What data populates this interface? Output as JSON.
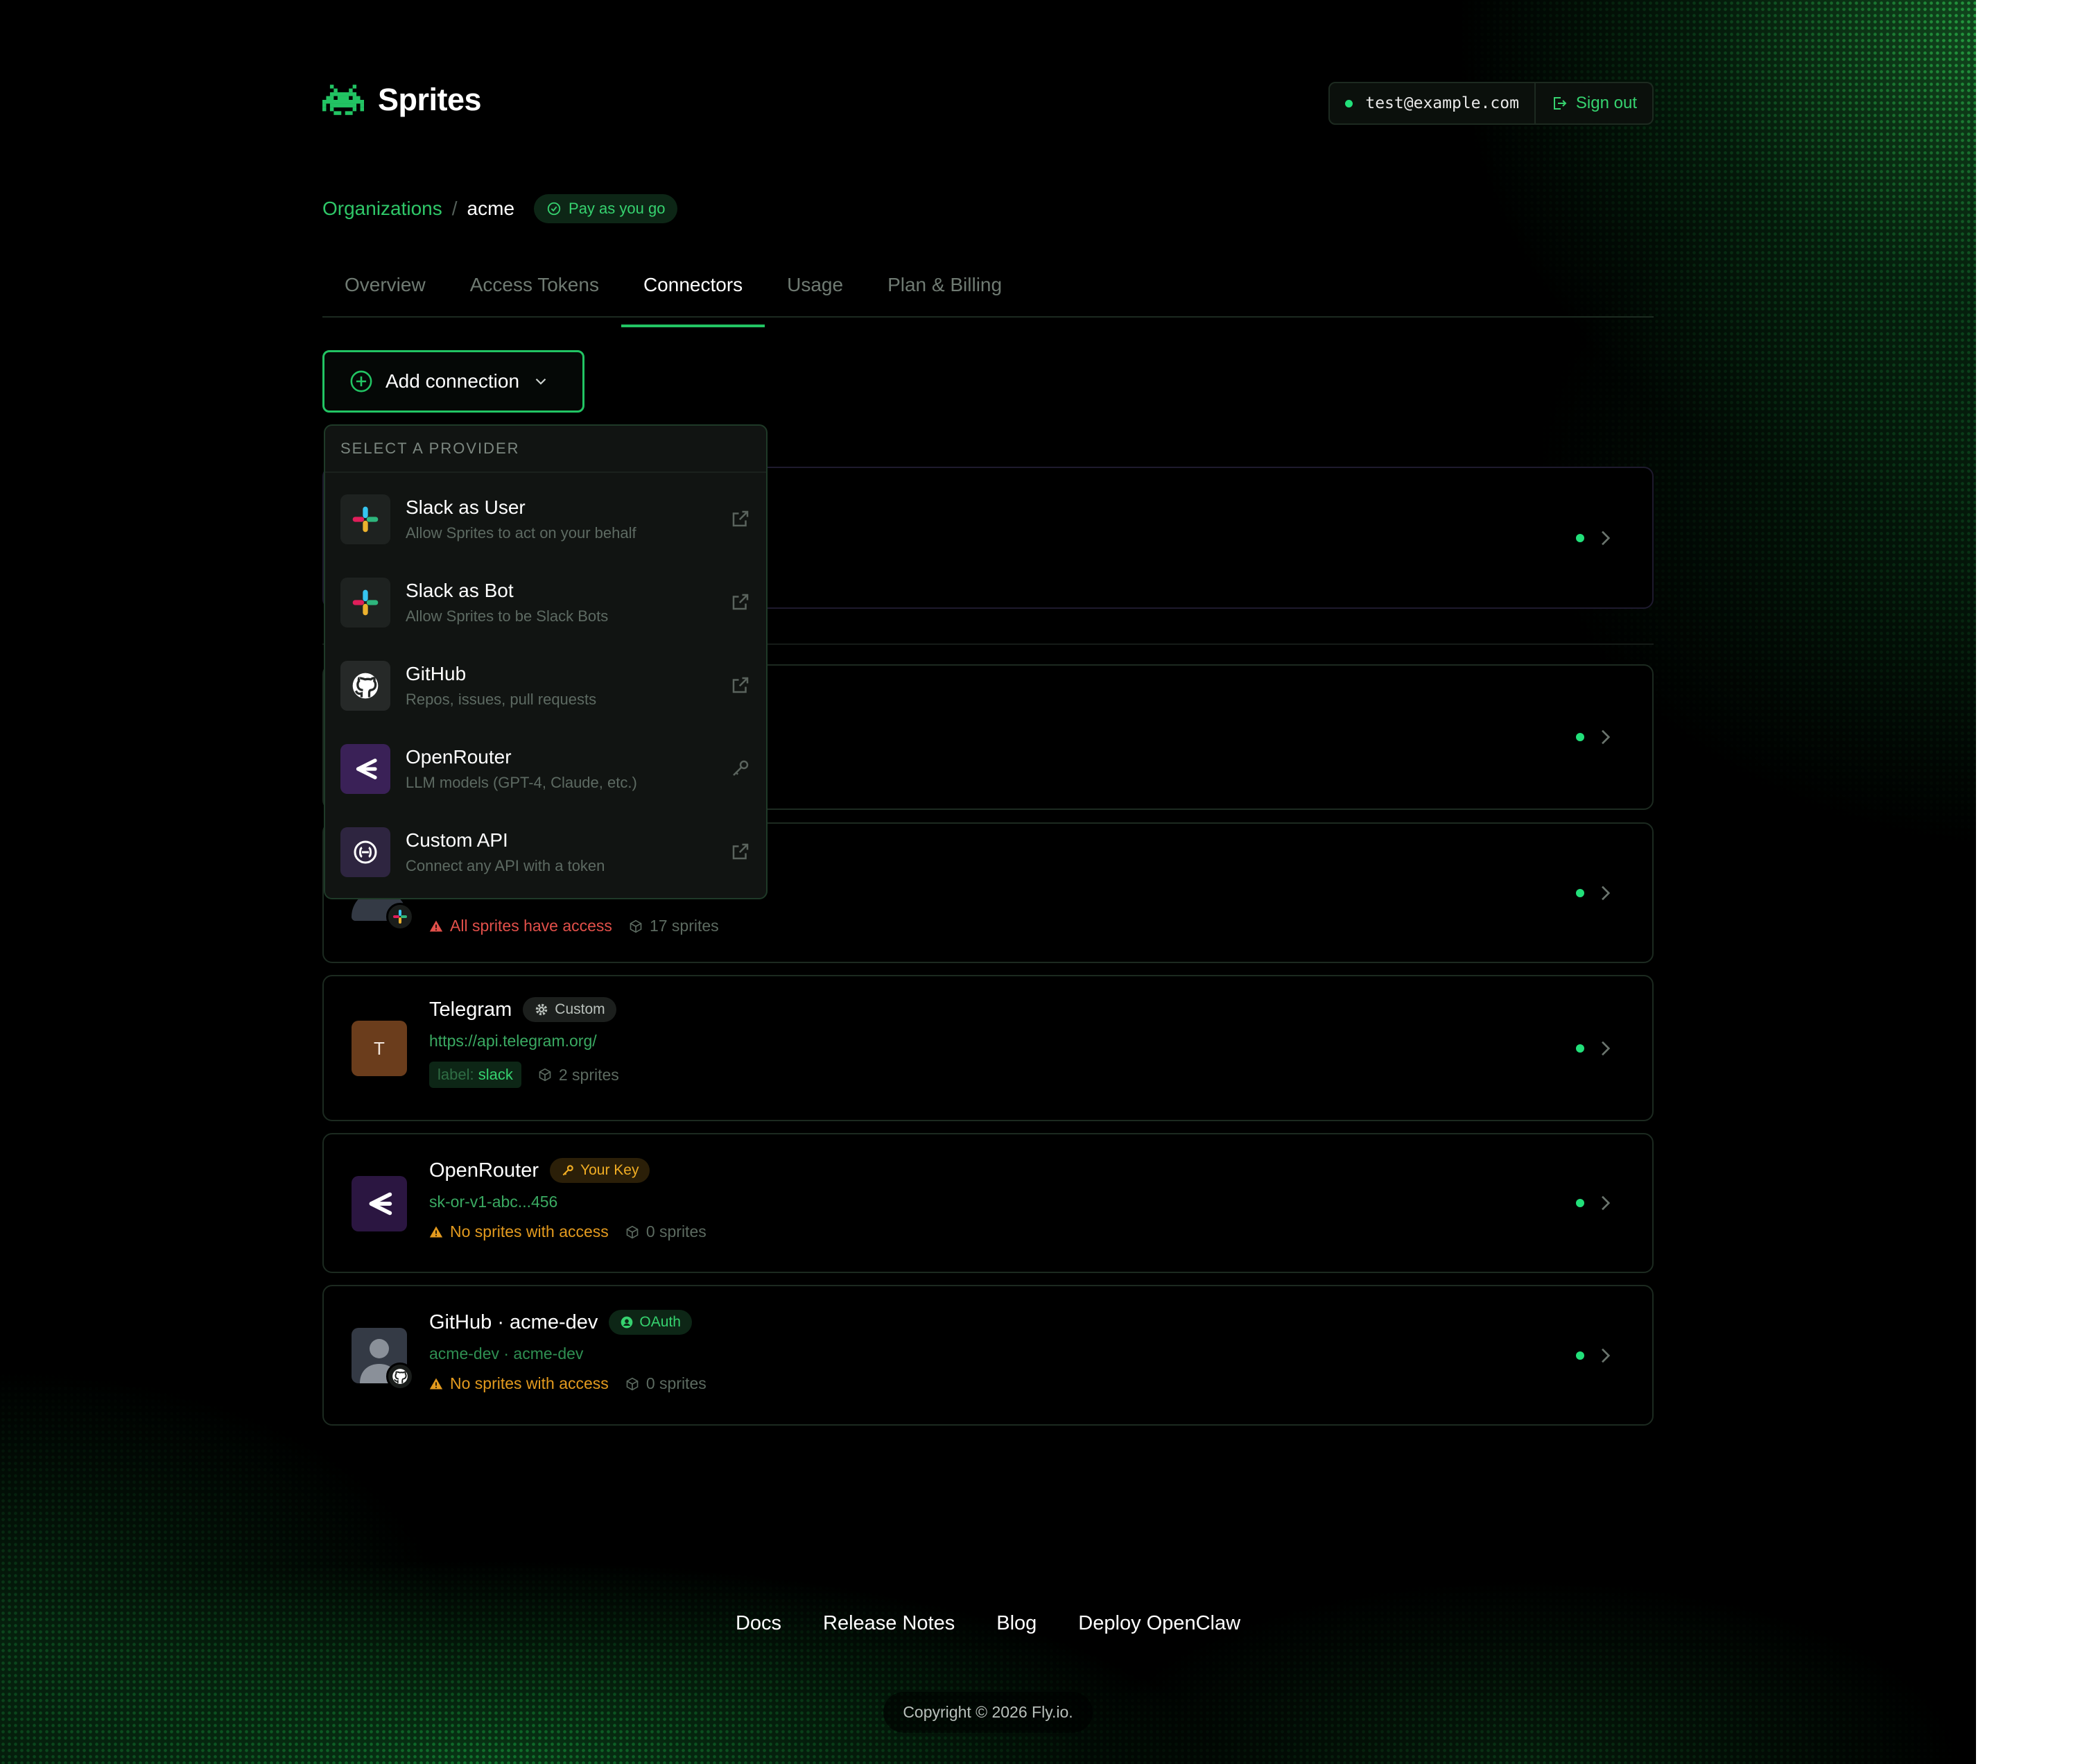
{
  "app": {
    "name": "Sprites"
  },
  "account": {
    "email": "test@example.com",
    "signout_label": "Sign out"
  },
  "breadcrumb": {
    "root": "Organizations",
    "separator": "/",
    "current": "acme",
    "plan": "Pay as you go"
  },
  "tabs": [
    {
      "label": "Overview"
    },
    {
      "label": "Access Tokens"
    },
    {
      "label": "Connectors",
      "active": true
    },
    {
      "label": "Usage"
    },
    {
      "label": "Plan & Billing"
    }
  ],
  "add_connection": {
    "label": "Add connection"
  },
  "dropdown": {
    "header": "SELECT A PROVIDER",
    "items": [
      {
        "title": "Slack as User",
        "desc": "Allow Sprites to act on your behalf",
        "icon": "slack-icon",
        "action_icon": "external-link-icon"
      },
      {
        "title": "Slack as Bot",
        "desc": "Allow Sprites to be Slack Bots",
        "icon": "slack-icon",
        "action_icon": "external-link-icon"
      },
      {
        "title": "GitHub",
        "desc": "Repos, issues, pull requests",
        "icon": "github-icon",
        "action_icon": "external-link-icon"
      },
      {
        "title": "OpenRouter",
        "desc": "LLM models (GPT-4, Claude, etc.)",
        "icon": "openrouter-icon",
        "action_icon": "key-icon"
      },
      {
        "title": "Custom API",
        "desc": "Connect any API with a token",
        "icon": "api-icon",
        "action_icon": "external-link-icon"
      }
    ]
  },
  "connections": [
    {
      "id": "slack-hidden",
      "warning": "All sprites have access",
      "sprites": "17 sprites"
    },
    {
      "id": "telegram",
      "title": "Telegram",
      "badge": "Custom",
      "avatar_letter": "T",
      "sub": "https://api.telegram.org/",
      "label_key": "label:",
      "label_value": "slack",
      "sprites": "2 sprites"
    },
    {
      "id": "openrouter",
      "title": "OpenRouter",
      "badge": "Your Key",
      "sub": "sk-or-v1-abc...456",
      "warning": "No sprites with access",
      "sprites": "0 sprites"
    },
    {
      "id": "github",
      "title": "GitHub · acme-dev",
      "badge": "OAuth",
      "sub": "acme-dev · acme-dev",
      "warning": "No sprites with access",
      "sprites": "0 sprites"
    }
  ],
  "footer": {
    "links": [
      "Docs",
      "Release Notes",
      "Blog",
      "Deploy OpenClaw"
    ],
    "copyright": "Copyright © 2026 Fly.io."
  },
  "colors": {
    "accent": "#22c463",
    "warning": "#e39a1e",
    "danger": "#e2504a",
    "background": "#000000"
  }
}
